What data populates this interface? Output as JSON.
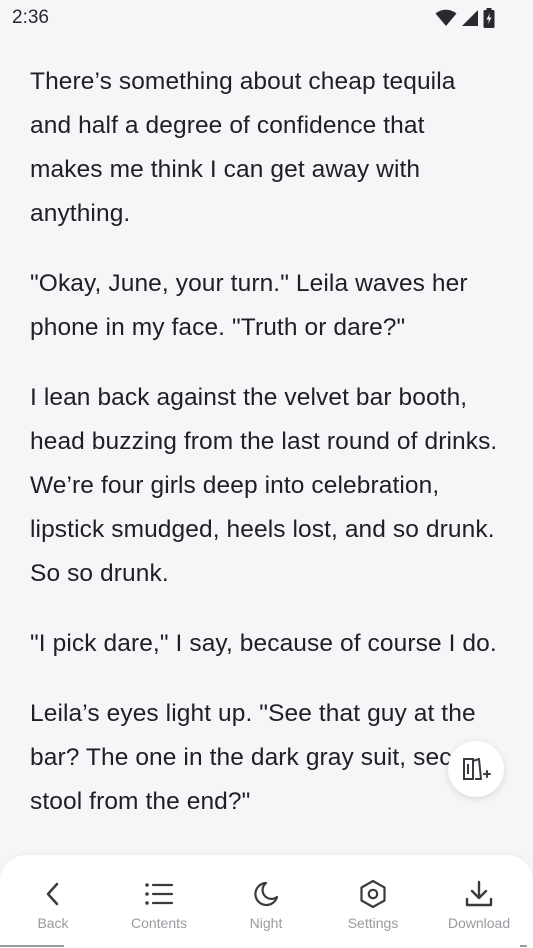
{
  "status_bar": {
    "time": "2:36",
    "icons": [
      "wifi-icon",
      "signal-icon",
      "battery-charging-icon"
    ]
  },
  "reader": {
    "paragraphs": [
      "There’s something about cheap tequila and half a degree of confidence that makes me think I can get away with anything.",
      "\"Okay, June, your turn.\" Leila waves her phone in my face. \"Truth or dare?\"",
      "I lean back against the velvet bar booth, head buzzing from the last round of drinks. We’re four girls deep into celebration, lipstick smudged, heels lost, and so drunk. So so drunk.",
      "\"I pick dare,\" I say, because of course I do.",
      "Leila’s eyes light up. \"See that guy at the bar? The one in the dark gray suit, second stool from the end?\""
    ]
  },
  "fab": {
    "icon": "read-aloud-add-icon"
  },
  "bottom_nav": {
    "items": [
      {
        "label": "Back",
        "icon": "chevron-left-icon"
      },
      {
        "label": "Contents",
        "icon": "list-icon"
      },
      {
        "label": "Night",
        "icon": "moon-icon"
      },
      {
        "label": "Settings",
        "icon": "hexagon-settings-icon"
      },
      {
        "label": "Download",
        "icon": "download-icon"
      }
    ]
  },
  "colors": {
    "background": "#f6f6f8",
    "text": "#1f1f24",
    "nav_label": "#9a9aa0",
    "nav_icon": "#3a3a40"
  }
}
